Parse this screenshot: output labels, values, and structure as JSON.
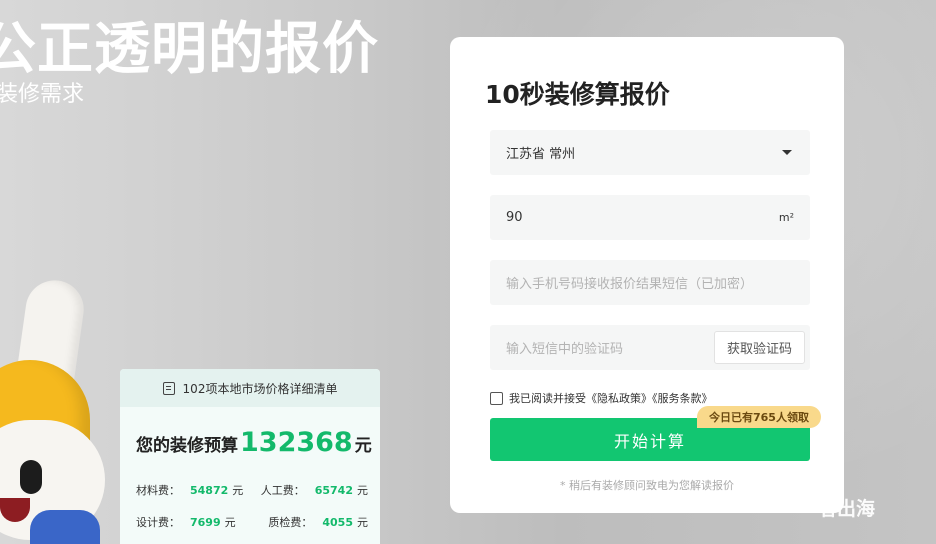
{
  "hero": {
    "title": "公正透明的报价",
    "subtitle": "装修需求"
  },
  "price_card": {
    "header": "102项本地市场价格详细清单",
    "budget_label": "您的装修预算",
    "budget_value": "132368",
    "budget_unit": "元",
    "fees": [
      {
        "label": "材料费：",
        "value": "54872",
        "unit": "元"
      },
      {
        "label": "人工费：",
        "value": "65742",
        "unit": "元"
      },
      {
        "label": "设计费：",
        "value": "7699",
        "unit": "元"
      },
      {
        "label": "质检费：",
        "value": "4055",
        "unit": "元"
      }
    ]
  },
  "form": {
    "title": "10秒装修算报价",
    "region_value": "江苏省 常州",
    "area_value": "90",
    "area_unit": "m²",
    "phone_placeholder": "输入手机号码接收报价结果短信（已加密）",
    "code_placeholder": "输入短信中的验证码",
    "code_button": "获取验证码",
    "agree_text": "我已阅读并接受《隐私政策》《服务条款》",
    "badge": "今日已有765人领取",
    "submit_label": "开始计算",
    "note": "* 稍后有装修顾问致电为您解读报价"
  },
  "watermark": "者出海",
  "colors": {
    "primary_green": "#12c671",
    "value_green": "#13b96b",
    "badge_bg": "#f9d98b"
  }
}
